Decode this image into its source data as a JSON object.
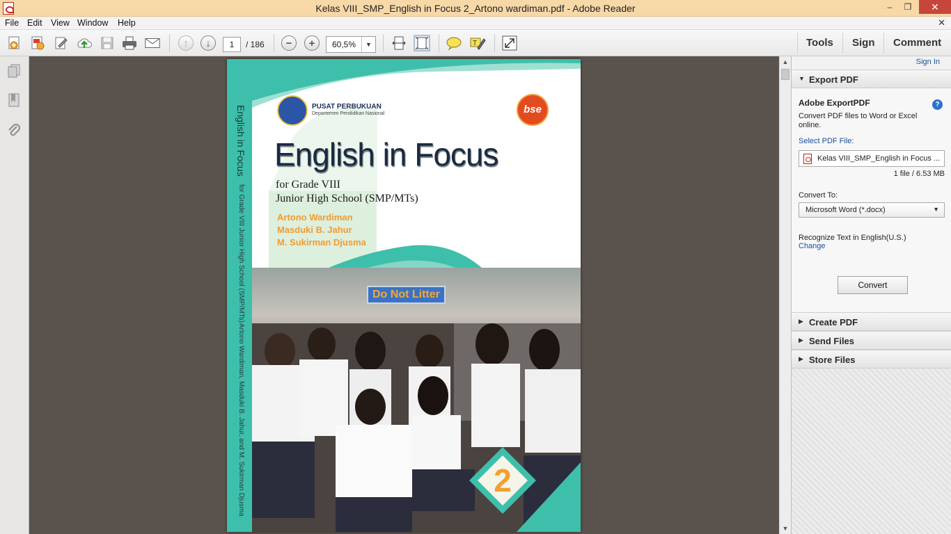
{
  "window": {
    "title": "Kelas VIII_SMP_English in Focus 2_Artono wardiman.pdf - Adobe Reader",
    "min": "‒",
    "max": "❐",
    "close": "✕"
  },
  "menu": {
    "items": [
      "File",
      "Edit",
      "View",
      "Window",
      "Help"
    ],
    "close": "✕"
  },
  "toolbar": {
    "page_current": "1",
    "page_total": "/ 186",
    "zoom": "60,5%",
    "tools_label": "Tools",
    "sign_label": "Sign",
    "comment_label": "Comment"
  },
  "cover": {
    "publisher": "PUSAT PERBUKUAN",
    "department": "Departemen Pendidikan Nasional",
    "badge": "bse",
    "title": "English in Focus",
    "grade": "for Grade VIII",
    "school": "Junior High School (SMP/MTs)",
    "authors": [
      "Artono Wardiman",
      "Masduki B. Jahur",
      "M. Sukirman Djusma"
    ],
    "sign": "Do Not Litter",
    "number": "2",
    "spine_title": "English in Focus",
    "spine_subtitle": "for Grade VIII Junior High School (SMP/MTs)",
    "spine_authors": "Artono Wardiman, Masduki B. Jahur, and M. Sukirman Djusma"
  },
  "right_panel": {
    "sign_in": "Sign In",
    "export_pdf": {
      "header": "Export PDF",
      "service": "Adobe ExportPDF",
      "description_line1": "Convert PDF files to Word or Excel",
      "description_line2": "online.",
      "select_label": "Select PDF File:",
      "file_name": "Kelas VIII_SMP_English in Focus ...",
      "file_info": "1 file / 6.53 MB",
      "convert_to_label": "Convert To:",
      "convert_to_value": "Microsoft Word (*.docx)",
      "recognize_text": "Recognize Text in English(U.S.)",
      "change_link": "Change",
      "convert_button": "Convert"
    },
    "sections": [
      "Create PDF",
      "Send Files",
      "Store Files"
    ]
  },
  "colors": {
    "titlebar": "#f7d8a7",
    "close_button": "#c7453b",
    "doc_background": "#5a534d",
    "cover_teal": "#3ebfab",
    "author_orange": "#f29c2e",
    "link_blue": "#1a4f9c"
  },
  "icons": [
    "create-pdf-icon",
    "create-pdf-doc-icon",
    "edit-icon",
    "upload-icon",
    "save-icon",
    "print-icon",
    "email-icon",
    "prev-page-icon",
    "next-page-icon",
    "zoom-out-icon",
    "zoom-in-icon",
    "fit-page-icon",
    "fit-width-icon",
    "sticky-note-icon",
    "highlight-icon",
    "full-screen-icon",
    "pages-icon",
    "bookmarks-icon",
    "attachments-icon",
    "help-icon"
  ]
}
